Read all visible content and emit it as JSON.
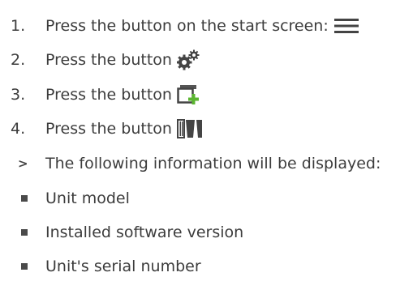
{
  "steps": [
    {
      "number": "1.",
      "text": "Press the button on the start screen:",
      "icon": "hamburger-menu-icon"
    },
    {
      "number": "2.",
      "text": "Press the button",
      "icon": "gears-icon"
    },
    {
      "number": "3.",
      "text": "Press the button",
      "icon": "add-window-icon"
    },
    {
      "number": "4.",
      "text": "Press the button",
      "icon": "unit-info-icon"
    }
  ],
  "result": {
    "marker": ">",
    "text": "The following information will be displayed:"
  },
  "info_items": [
    "Unit model",
    "Installed software version",
    "Unit's serial number"
  ],
  "colors": {
    "text": "#3c3c3c",
    "icon": "#444444",
    "accent_green": "#5bb531"
  }
}
